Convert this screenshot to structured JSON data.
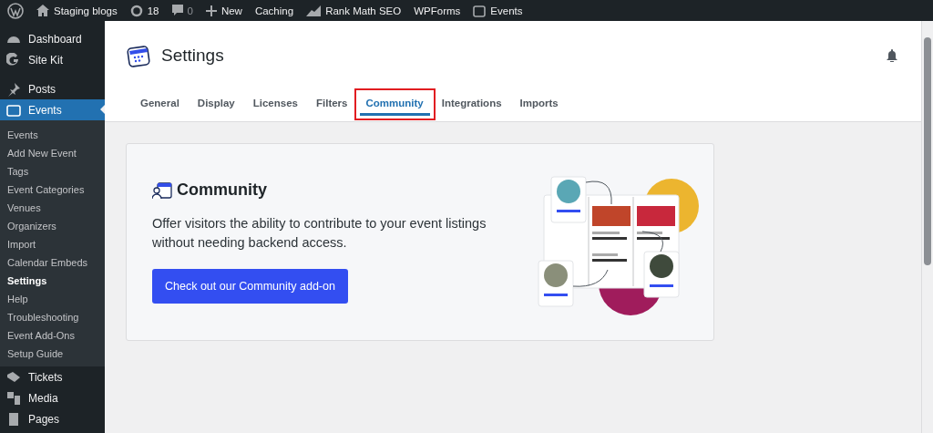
{
  "admin_bar": {
    "site": "Staging blogs",
    "updates": "18",
    "comments": "0",
    "new": "New",
    "items": [
      "Caching",
      "Rank Math SEO",
      "WPForms",
      "Events"
    ]
  },
  "sidebar": {
    "items": [
      {
        "label": "Dashboard",
        "selected": false
      },
      {
        "label": "Site Kit",
        "selected": false
      },
      {
        "label": "Posts",
        "selected": false
      },
      {
        "label": "Events",
        "selected": true,
        "children": [
          {
            "label": "Events",
            "selected": false
          },
          {
            "label": "Add New Event",
            "selected": false
          },
          {
            "label": "Tags",
            "selected": false
          },
          {
            "label": "Event Categories",
            "selected": false
          },
          {
            "label": "Venues",
            "selected": false
          },
          {
            "label": "Organizers",
            "selected": false
          },
          {
            "label": "Import",
            "selected": false
          },
          {
            "label": "Calendar Embeds",
            "selected": false
          },
          {
            "label": "Settings",
            "selected": true
          },
          {
            "label": "Help",
            "selected": false
          },
          {
            "label": "Troubleshooting",
            "selected": false
          },
          {
            "label": "Event Add-Ons",
            "selected": false
          },
          {
            "label": "Setup Guide",
            "selected": false
          }
        ]
      },
      {
        "label": "Tickets",
        "selected": false
      },
      {
        "label": "Media",
        "selected": false
      },
      {
        "label": "Pages",
        "selected": false
      }
    ]
  },
  "header": {
    "title": "Settings"
  },
  "tabs": [
    {
      "label": "General",
      "selected": false,
      "highlighted": false
    },
    {
      "label": "Display",
      "selected": false,
      "highlighted": false
    },
    {
      "label": "Licenses",
      "selected": false,
      "highlighted": false
    },
    {
      "label": "Filters",
      "selected": false,
      "highlighted": false
    },
    {
      "label": "Community",
      "selected": true,
      "highlighted": true
    },
    {
      "label": "Integrations",
      "selected": false,
      "highlighted": false
    },
    {
      "label": "Imports",
      "selected": false,
      "highlighted": false
    }
  ],
  "card": {
    "title": "Community",
    "description": "Offer visitors the ability to contribute to your event listings without needing backend access.",
    "button": "Check out our Community add-on"
  }
}
